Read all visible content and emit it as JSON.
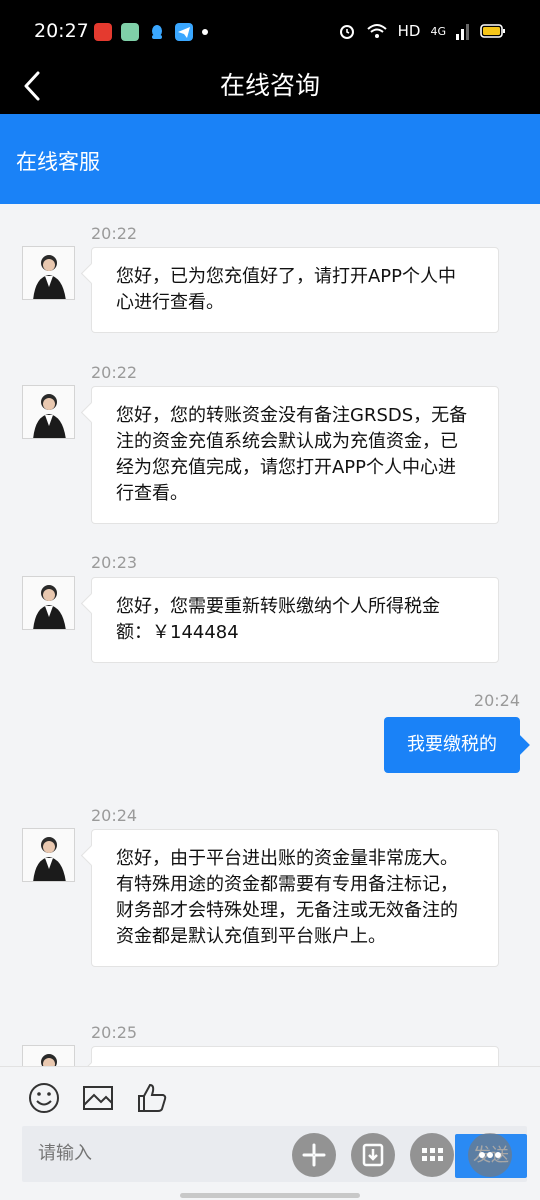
{
  "status_bar": {
    "time": "20:27",
    "network_label": "HD",
    "signal_label": "4G"
  },
  "header": {
    "title": "在线咨询",
    "service_label": "在线客服"
  },
  "messages": [
    {
      "sender": "agent",
      "time": "20:22",
      "text": "您好，已为您充值好了，请打开APP个人中心进行查看。"
    },
    {
      "sender": "agent",
      "time": "20:22",
      "text": "您好，您的转账资金没有备注GRSDS，无备注的资金充值系统会默认成为充值资金，已经为您充值完成，请您打开APP个人中心进行查看。"
    },
    {
      "sender": "agent",
      "time": "20:23",
      "text": "您好，您需要重新转账缴纳个人所得税金额：￥144484"
    },
    {
      "sender": "user",
      "time": "20:24",
      "text": "我要缴税的"
    },
    {
      "sender": "agent",
      "time": "20:24",
      "text": "您好，由于平台进出账的资金量非常庞大。有特殊用途的资金都需要有专用备注标记，财务部才会特殊处理，无备注或无效备注的资金都是默认充值到平台账户上。"
    },
    {
      "sender": "agent",
      "time": "20:25",
      "text": ""
    }
  ],
  "input": {
    "placeholder": "请输入",
    "send_label": "发送"
  },
  "colors": {
    "accent": "#1a82f7",
    "topbar": "#000000",
    "background": "#f3f4f6"
  },
  "icons": {
    "toolbar": [
      "smile-icon",
      "image-icon",
      "thumbs-up-icon"
    ],
    "input_actions": [
      "sparkle-icon",
      "download-icon",
      "grid-icon",
      "more-icon"
    ]
  }
}
